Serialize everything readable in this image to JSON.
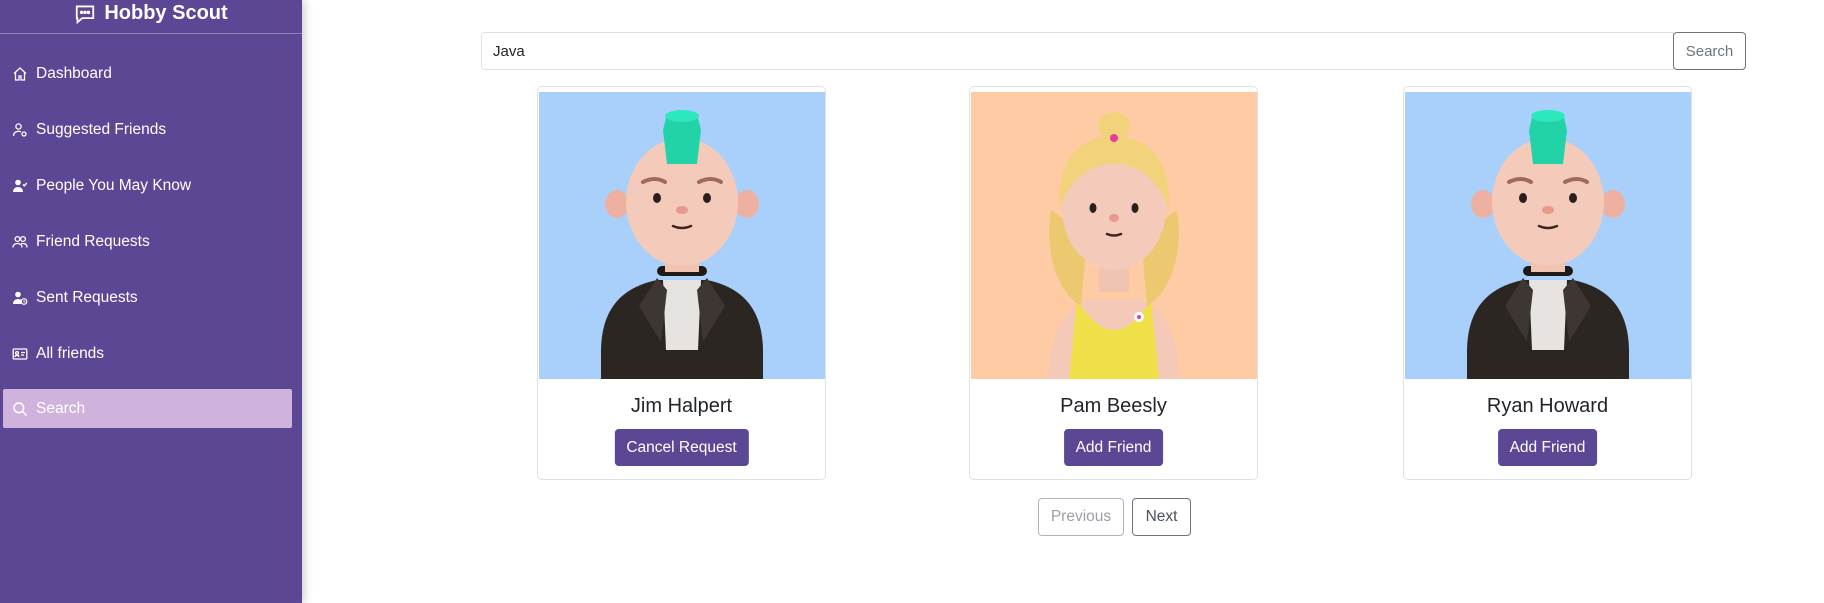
{
  "app": {
    "title": "Hobby Scout",
    "icon": "chat-dots-icon"
  },
  "sidebar": {
    "items": [
      {
        "label": "Dashboard",
        "icon": "house-icon"
      },
      {
        "label": "Suggested Friends",
        "icon": "person-gear-icon"
      },
      {
        "label": "People You May Know",
        "icon": "person-check-icon"
      },
      {
        "label": "Friend Requests",
        "icon": "people-icon"
      },
      {
        "label": "Sent Requests",
        "icon": "person-clock-icon"
      },
      {
        "label": "All friends",
        "icon": "person-vcard-icon"
      },
      {
        "label": "Search",
        "icon": "search-icon",
        "active": true
      }
    ],
    "accent": "#5c4795",
    "active_bg": "#d0b3dd"
  },
  "search": {
    "value": "Java",
    "button_label": "Search"
  },
  "results": [
    {
      "name": "Jim Halpert",
      "action": "Cancel Request",
      "avatar": "punk-boy-avatar",
      "bg": "#a8d0fb"
    },
    {
      "name": "Pam Beesly",
      "action": "Add Friend",
      "avatar": "blonde-girl-avatar",
      "bg": "#ffcba4"
    },
    {
      "name": "Ryan Howard",
      "action": "Add Friend",
      "avatar": "punk-boy-avatar",
      "bg": "#a8d0fb"
    }
  ],
  "pagination": {
    "previous_label": "Previous",
    "next_label": "Next"
  }
}
